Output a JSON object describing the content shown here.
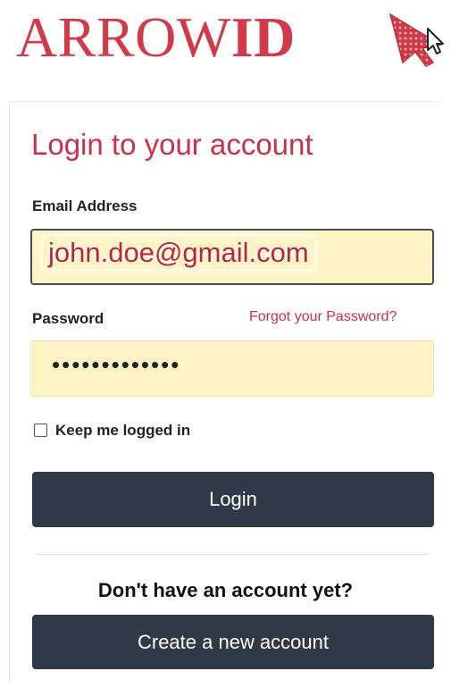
{
  "logo": {
    "text_regular": "ARROW",
    "text_bold": "ID",
    "icon": "arrow-cursor-icon",
    "brand_color": "#d23a4a"
  },
  "form": {
    "title": "Login to your account",
    "email": {
      "label": "Email Address",
      "value": "john.doe@gmail.com"
    },
    "password": {
      "label": "Password",
      "forgot_link": "Forgot your Password?",
      "masked_value": "•••••••••••••"
    },
    "remember": {
      "label": "Keep me logged in",
      "checked": false
    },
    "login_button": "Login"
  },
  "signup": {
    "prompt": "Don't have an account yet?",
    "button": "Create a new account"
  },
  "colors": {
    "accent": "#c9304a",
    "button": "#2e3a48",
    "input_bg": "#fdf3c4"
  }
}
